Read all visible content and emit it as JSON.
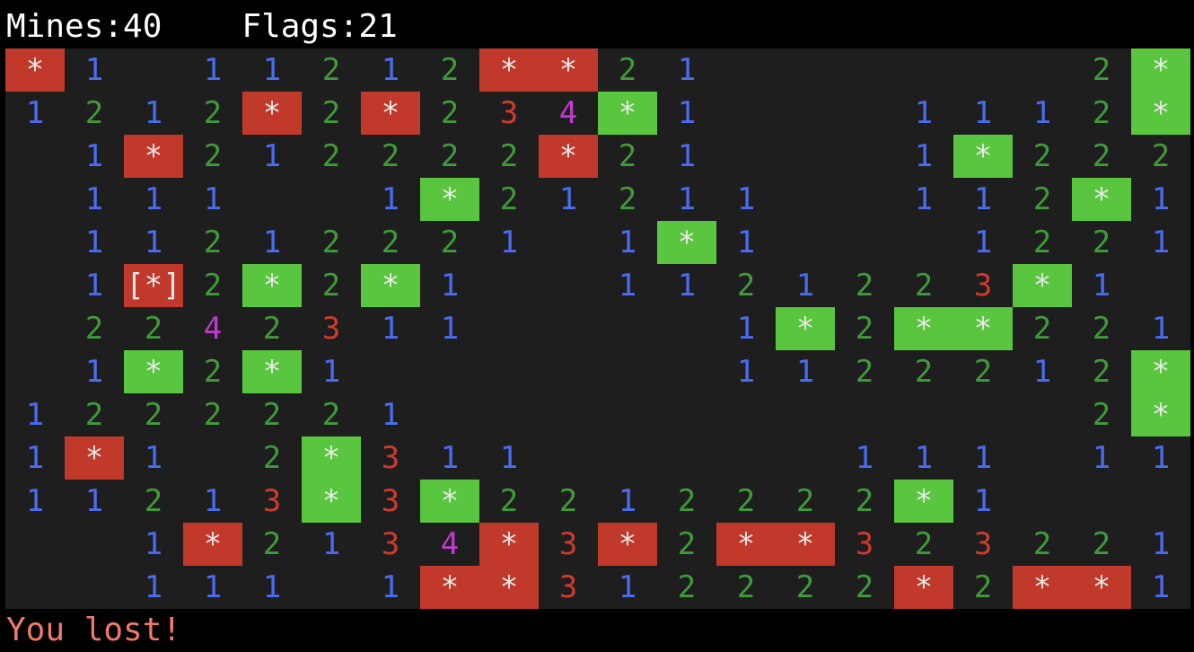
{
  "status": {
    "mines_label": "Mines:40",
    "flags_label": "Flags:21"
  },
  "message": {
    "text": "You lost!",
    "color": "#f07a6a"
  },
  "colors": {
    "board_bg": "#1e1e1e",
    "mine_red": "#c0392b",
    "mine_green": "#5ac63f",
    "n1": "#4a6cf0",
    "n2": "#3f9a3a",
    "n3": "#d03a2e",
    "n4": "#c03ad0"
  },
  "legend": {
    "R": "exploded/unflagged mine (red)",
    "G": "flagged mine (green)",
    "X": "selected cell with cursor"
  },
  "board": {
    "cols": 20,
    "rows_count": 13,
    "rows": [
      "R1.1121.2RR21.....2G",
      "1212R2R2344G1...1112G",
      "..1R212222R21...1G222",
      ".111...1G212111..11G21",
      ".11212221.1G1....1221",
      ".1X2G2G1..1121223G1.",
      ".2242311...1G2GG221",
      ".1G2G1.....1122212G",
      "122222.1..........2G",
      "1R1.2G311....111.11",
      "1121 3G3G22122222G1.",
      "..1R2133432R2RR32322 1",
      "..111.1RR31222 2R2RR1"
    ]
  },
  "grid": [
    [
      "R",
      "1",
      "",
      "1",
      "1",
      "2",
      "1",
      "2",
      "R",
      "R",
      "2",
      "1",
      "",
      "",
      "",
      "",
      "",
      "",
      "2",
      "G"
    ],
    [
      "1",
      "2",
      "1",
      "2",
      "R",
      "2",
      "R",
      "2",
      "3",
      "4",
      "G",
      "1",
      "",
      "",
      "",
      "1",
      "1",
      "1",
      "2",
      "G"
    ],
    [
      "",
      "1",
      "R",
      "2",
      "1",
      "2",
      "2",
      "2",
      "2",
      "R",
      "2",
      "1",
      "",
      "",
      "",
      "1",
      "G",
      "2",
      "2",
      "2"
    ],
    [
      "",
      "1",
      "1",
      "1",
      "",
      "",
      "1",
      "G",
      "2",
      "1",
      "2",
      "1",
      "1",
      "",
      "",
      "1",
      "1",
      "2",
      "G",
      "1"
    ],
    [
      "",
      "1",
      "1",
      "2",
      "1",
      "2",
      "2",
      "2",
      "1",
      "",
      "1",
      "G",
      "1",
      "",
      "",
      "",
      "1",
      "2",
      "2",
      "1"
    ],
    [
      "",
      "1",
      "X",
      "2",
      "G",
      "2",
      "G",
      "1",
      "",
      "",
      "1",
      "1",
      "2",
      "1",
      "2",
      "2",
      "3",
      "G",
      "1",
      ""
    ],
    [
      "",
      "2",
      "2",
      "4",
      "2",
      "3",
      "1",
      "1",
      "",
      "",
      "",
      "",
      "1",
      "G",
      "2",
      "G",
      "G",
      "2",
      "2",
      "1"
    ],
    [
      "",
      "1",
      "G",
      "2",
      "G",
      "1",
      "",
      "",
      "",
      "",
      "",
      "",
      "1",
      "1",
      "2",
      "2",
      "2",
      "1",
      "2",
      "G"
    ],
    [
      "1",
      "2",
      "2",
      "2",
      "2",
      "2",
      "1",
      "",
      "",
      "",
      "",
      "",
      "",
      "",
      "",
      "",
      "",
      "",
      "2",
      "G"
    ],
    [
      "1",
      "R",
      "1",
      "",
      "2",
      "G",
      "3",
      "1",
      "1",
      "",
      "",
      "",
      "",
      "",
      "1",
      "1",
      "1",
      "",
      "1",
      "1"
    ],
    [
      "1",
      "1",
      "2",
      "1",
      "3",
      "G",
      "3",
      "G",
      "2",
      "2",
      "1",
      "2",
      "2",
      "2",
      "2",
      "G",
      "1",
      "",
      "",
      ""
    ],
    [
      "",
      "",
      "1",
      "R",
      "2",
      "1",
      "3",
      "4",
      "R",
      "3",
      "R",
      "2",
      "R",
      "R",
      "3",
      "2",
      "3",
      "2",
      "2",
      "1"
    ],
    [
      "",
      "",
      "1",
      "1",
      "1",
      "",
      "1",
      "R",
      "R",
      "3",
      "1",
      "2",
      "2",
      "2",
      "2",
      "R",
      "2",
      "R",
      "R",
      "1"
    ]
  ]
}
